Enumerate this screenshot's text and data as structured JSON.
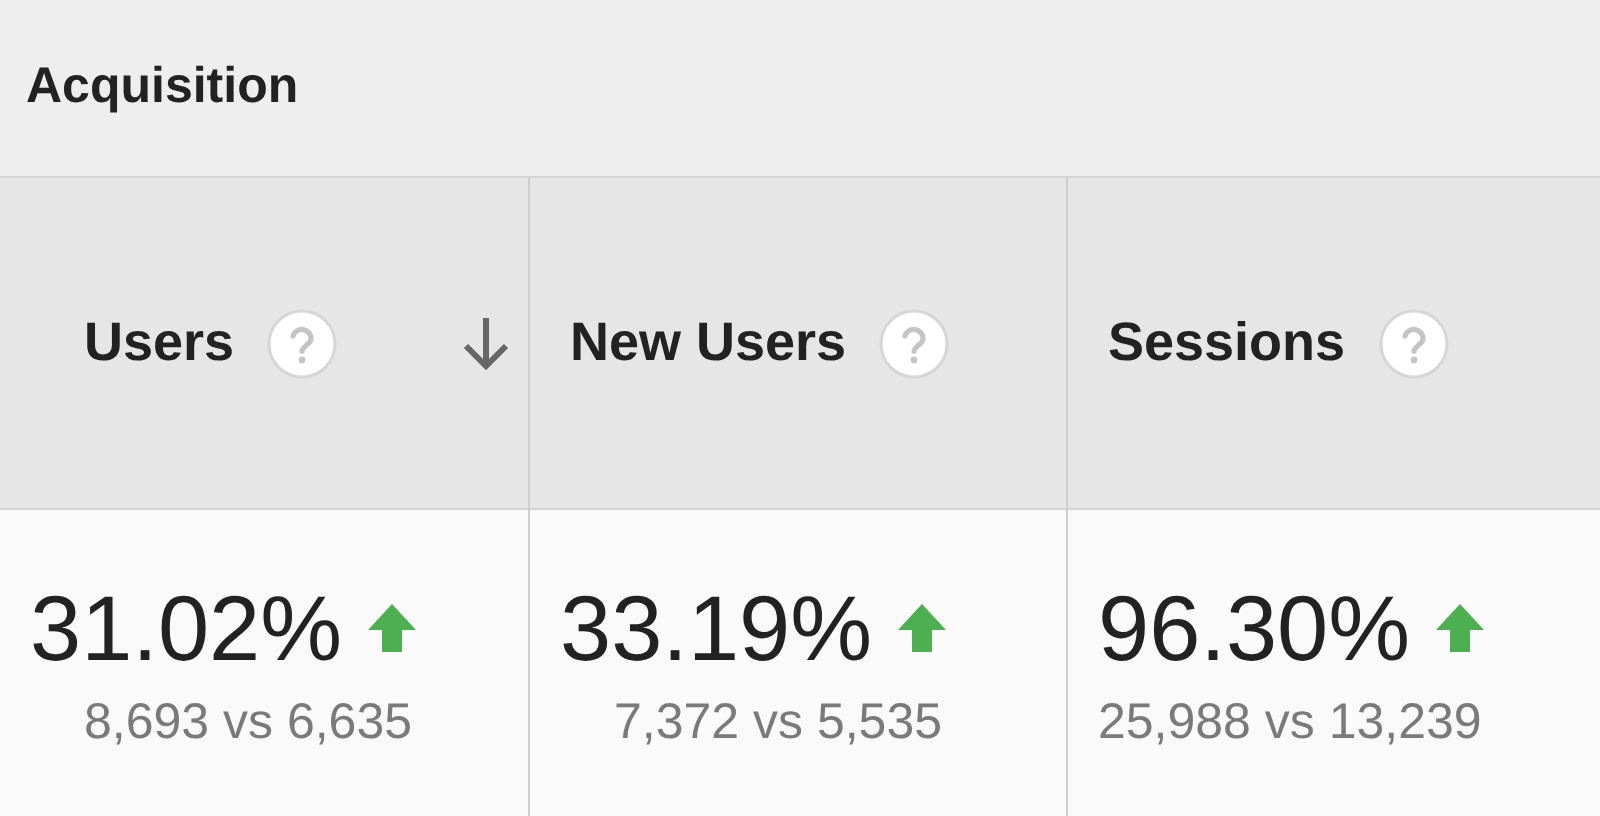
{
  "section": {
    "title": "Acquisition"
  },
  "columns": [
    {
      "label": "Users",
      "sorted": true,
      "percent": "31.02%",
      "kind": "up",
      "comparison": "8,693 vs 6,635"
    },
    {
      "label": "New Users",
      "sorted": false,
      "percent": "33.19%",
      "kind": "up",
      "comparison": "7,372 vs 5,535"
    },
    {
      "label": "Sessions",
      "sorted": false,
      "percent": "96.30%",
      "kind": "up",
      "comparison": "25,988 vs 13,239"
    }
  ]
}
